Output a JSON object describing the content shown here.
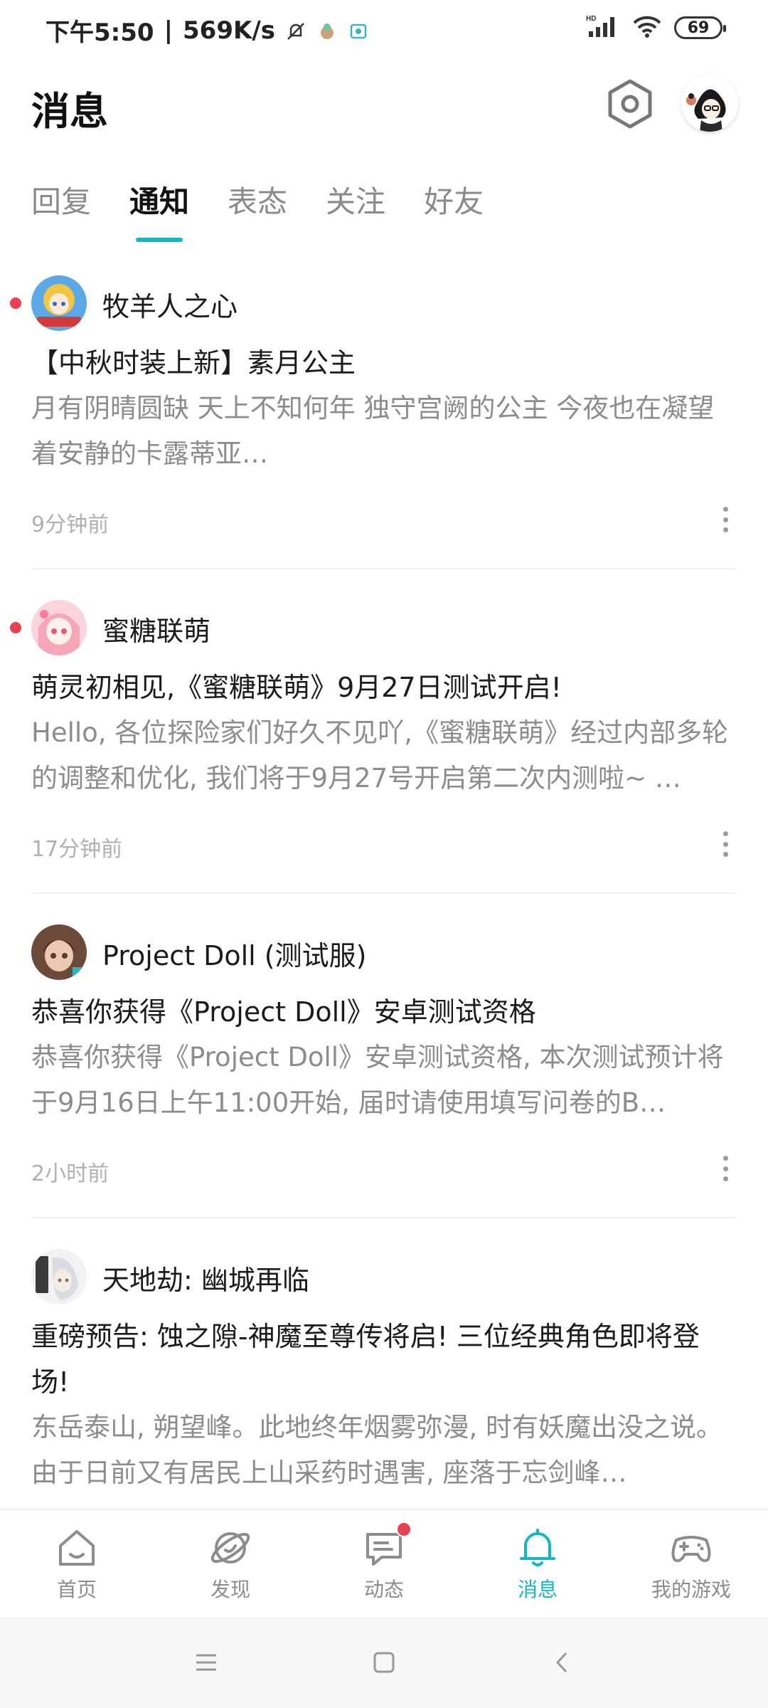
{
  "status_bar": {
    "time": "下午5:50",
    "speed": "569K/s",
    "network": "HD",
    "battery": "69"
  },
  "header": {
    "title": "消息"
  },
  "tabs": [
    {
      "label": "回复",
      "active": false
    },
    {
      "label": "通知",
      "active": true
    },
    {
      "label": "表态",
      "active": false
    },
    {
      "label": "关注",
      "active": false
    },
    {
      "label": "好友",
      "active": false
    }
  ],
  "notifications": [
    {
      "sender": "牧羊人之心",
      "unread": true,
      "title": "【中秋时装上新】素月公主",
      "body": "月有阴晴圆缺 天上不知何年 独守宫阙的公主 今夜也在凝望着安静的卡露蒂亚 ——————————————————…",
      "time": "9分钟前"
    },
    {
      "sender": "蜜糖联萌",
      "unread": true,
      "title": "萌灵初相见,《蜜糖联萌》9月27日测试开启!",
      "body": "Hello, 各位探险家们好久不见吖,《蜜糖联萌》经过内部多轮的调整和优化, 我们将于9月27号开启第二次内测啦~ …",
      "time": "17分钟前"
    },
    {
      "sender": "Project Doll (测试服)",
      "unread": false,
      "title": "恭喜你获得《Project Doll》安卓测试资格",
      "body": "恭喜你获得《Project Doll》安卓测试资格, 本次测试预计将于9月16日上午11:00开始, 届时请使用填写问卷的B…",
      "time": "2小时前"
    },
    {
      "sender": "天地劫: 幽城再临",
      "unread": false,
      "title": "重磅预告: 蚀之隙-神魔至尊传将启! 三位经典角色即将登场!",
      "body": "东岳泰山, 朔望峰。此地终年烟雾弥漫, 时有妖魔出没之说。由于日前又有居民上山采药时遇害, 座落于忘剑峰…",
      "time": ""
    }
  ],
  "bottom_nav": [
    {
      "label": "首页",
      "icon": "home-icon",
      "active": false
    },
    {
      "label": "发现",
      "icon": "discover-icon",
      "active": false
    },
    {
      "label": "动态",
      "icon": "chat-icon",
      "active": false,
      "badge": true
    },
    {
      "label": "消息",
      "icon": "bell-icon",
      "active": true
    },
    {
      "label": "我的游戏",
      "icon": "gamepad-icon",
      "active": false
    }
  ],
  "colors": {
    "accent": "#14b8c4",
    "unread": "#e94152",
    "secondary_text": "#8c8c8c"
  }
}
